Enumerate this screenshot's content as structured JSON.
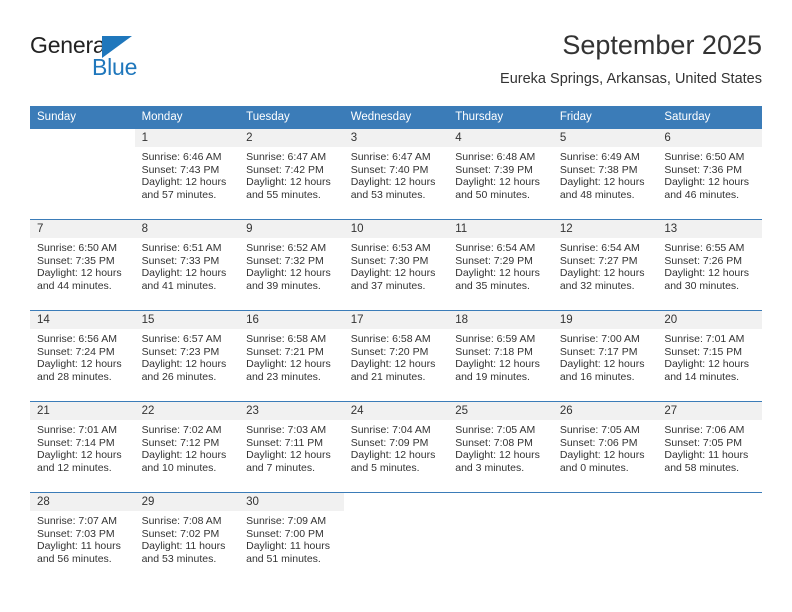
{
  "brand": {
    "name_part1": "General",
    "name_part2": "Blue",
    "accent_color": "#1f77bc"
  },
  "header": {
    "title": "September 2025",
    "subtitle": "Eureka Springs, Arkansas, United States"
  },
  "colors": {
    "header_blue": "#3b7cb8",
    "daynum_background": "#f1f1f1",
    "text": "#333333"
  },
  "weekday_headers": [
    "Sunday",
    "Monday",
    "Tuesday",
    "Wednesday",
    "Thursday",
    "Friday",
    "Saturday"
  ],
  "weeks": [
    [
      {
        "day": "",
        "sunrise": "",
        "sunset": "",
        "daylight_line1": "",
        "daylight_line2": ""
      },
      {
        "day": "1",
        "sunrise": "Sunrise: 6:46 AM",
        "sunset": "Sunset: 7:43 PM",
        "daylight_line1": "Daylight: 12 hours",
        "daylight_line2": "and 57 minutes."
      },
      {
        "day": "2",
        "sunrise": "Sunrise: 6:47 AM",
        "sunset": "Sunset: 7:42 PM",
        "daylight_line1": "Daylight: 12 hours",
        "daylight_line2": "and 55 minutes."
      },
      {
        "day": "3",
        "sunrise": "Sunrise: 6:47 AM",
        "sunset": "Sunset: 7:40 PM",
        "daylight_line1": "Daylight: 12 hours",
        "daylight_line2": "and 53 minutes."
      },
      {
        "day": "4",
        "sunrise": "Sunrise: 6:48 AM",
        "sunset": "Sunset: 7:39 PM",
        "daylight_line1": "Daylight: 12 hours",
        "daylight_line2": "and 50 minutes."
      },
      {
        "day": "5",
        "sunrise": "Sunrise: 6:49 AM",
        "sunset": "Sunset: 7:38 PM",
        "daylight_line1": "Daylight: 12 hours",
        "daylight_line2": "and 48 minutes."
      },
      {
        "day": "6",
        "sunrise": "Sunrise: 6:50 AM",
        "sunset": "Sunset: 7:36 PM",
        "daylight_line1": "Daylight: 12 hours",
        "daylight_line2": "and 46 minutes."
      }
    ],
    [
      {
        "day": "7",
        "sunrise": "Sunrise: 6:50 AM",
        "sunset": "Sunset: 7:35 PM",
        "daylight_line1": "Daylight: 12 hours",
        "daylight_line2": "and 44 minutes."
      },
      {
        "day": "8",
        "sunrise": "Sunrise: 6:51 AM",
        "sunset": "Sunset: 7:33 PM",
        "daylight_line1": "Daylight: 12 hours",
        "daylight_line2": "and 41 minutes."
      },
      {
        "day": "9",
        "sunrise": "Sunrise: 6:52 AM",
        "sunset": "Sunset: 7:32 PM",
        "daylight_line1": "Daylight: 12 hours",
        "daylight_line2": "and 39 minutes."
      },
      {
        "day": "10",
        "sunrise": "Sunrise: 6:53 AM",
        "sunset": "Sunset: 7:30 PM",
        "daylight_line1": "Daylight: 12 hours",
        "daylight_line2": "and 37 minutes."
      },
      {
        "day": "11",
        "sunrise": "Sunrise: 6:54 AM",
        "sunset": "Sunset: 7:29 PM",
        "daylight_line1": "Daylight: 12 hours",
        "daylight_line2": "and 35 minutes."
      },
      {
        "day": "12",
        "sunrise": "Sunrise: 6:54 AM",
        "sunset": "Sunset: 7:27 PM",
        "daylight_line1": "Daylight: 12 hours",
        "daylight_line2": "and 32 minutes."
      },
      {
        "day": "13",
        "sunrise": "Sunrise: 6:55 AM",
        "sunset": "Sunset: 7:26 PM",
        "daylight_line1": "Daylight: 12 hours",
        "daylight_line2": "and 30 minutes."
      }
    ],
    [
      {
        "day": "14",
        "sunrise": "Sunrise: 6:56 AM",
        "sunset": "Sunset: 7:24 PM",
        "daylight_line1": "Daylight: 12 hours",
        "daylight_line2": "and 28 minutes."
      },
      {
        "day": "15",
        "sunrise": "Sunrise: 6:57 AM",
        "sunset": "Sunset: 7:23 PM",
        "daylight_line1": "Daylight: 12 hours",
        "daylight_line2": "and 26 minutes."
      },
      {
        "day": "16",
        "sunrise": "Sunrise: 6:58 AM",
        "sunset": "Sunset: 7:21 PM",
        "daylight_line1": "Daylight: 12 hours",
        "daylight_line2": "and 23 minutes."
      },
      {
        "day": "17",
        "sunrise": "Sunrise: 6:58 AM",
        "sunset": "Sunset: 7:20 PM",
        "daylight_line1": "Daylight: 12 hours",
        "daylight_line2": "and 21 minutes."
      },
      {
        "day": "18",
        "sunrise": "Sunrise: 6:59 AM",
        "sunset": "Sunset: 7:18 PM",
        "daylight_line1": "Daylight: 12 hours",
        "daylight_line2": "and 19 minutes."
      },
      {
        "day": "19",
        "sunrise": "Sunrise: 7:00 AM",
        "sunset": "Sunset: 7:17 PM",
        "daylight_line1": "Daylight: 12 hours",
        "daylight_line2": "and 16 minutes."
      },
      {
        "day": "20",
        "sunrise": "Sunrise: 7:01 AM",
        "sunset": "Sunset: 7:15 PM",
        "daylight_line1": "Daylight: 12 hours",
        "daylight_line2": "and 14 minutes."
      }
    ],
    [
      {
        "day": "21",
        "sunrise": "Sunrise: 7:01 AM",
        "sunset": "Sunset: 7:14 PM",
        "daylight_line1": "Daylight: 12 hours",
        "daylight_line2": "and 12 minutes."
      },
      {
        "day": "22",
        "sunrise": "Sunrise: 7:02 AM",
        "sunset": "Sunset: 7:12 PM",
        "daylight_line1": "Daylight: 12 hours",
        "daylight_line2": "and 10 minutes."
      },
      {
        "day": "23",
        "sunrise": "Sunrise: 7:03 AM",
        "sunset": "Sunset: 7:11 PM",
        "daylight_line1": "Daylight: 12 hours",
        "daylight_line2": "and 7 minutes."
      },
      {
        "day": "24",
        "sunrise": "Sunrise: 7:04 AM",
        "sunset": "Sunset: 7:09 PM",
        "daylight_line1": "Daylight: 12 hours",
        "daylight_line2": "and 5 minutes."
      },
      {
        "day": "25",
        "sunrise": "Sunrise: 7:05 AM",
        "sunset": "Sunset: 7:08 PM",
        "daylight_line1": "Daylight: 12 hours",
        "daylight_line2": "and 3 minutes."
      },
      {
        "day": "26",
        "sunrise": "Sunrise: 7:05 AM",
        "sunset": "Sunset: 7:06 PM",
        "daylight_line1": "Daylight: 12 hours",
        "daylight_line2": "and 0 minutes."
      },
      {
        "day": "27",
        "sunrise": "Sunrise: 7:06 AM",
        "sunset": "Sunset: 7:05 PM",
        "daylight_line1": "Daylight: 11 hours",
        "daylight_line2": "and 58 minutes."
      }
    ],
    [
      {
        "day": "28",
        "sunrise": "Sunrise: 7:07 AM",
        "sunset": "Sunset: 7:03 PM",
        "daylight_line1": "Daylight: 11 hours",
        "daylight_line2": "and 56 minutes."
      },
      {
        "day": "29",
        "sunrise": "Sunrise: 7:08 AM",
        "sunset": "Sunset: 7:02 PM",
        "daylight_line1": "Daylight: 11 hours",
        "daylight_line2": "and 53 minutes."
      },
      {
        "day": "30",
        "sunrise": "Sunrise: 7:09 AM",
        "sunset": "Sunset: 7:00 PM",
        "daylight_line1": "Daylight: 11 hours",
        "daylight_line2": "and 51 minutes."
      },
      {
        "day": "",
        "sunrise": "",
        "sunset": "",
        "daylight_line1": "",
        "daylight_line2": ""
      },
      {
        "day": "",
        "sunrise": "",
        "sunset": "",
        "daylight_line1": "",
        "daylight_line2": ""
      },
      {
        "day": "",
        "sunrise": "",
        "sunset": "",
        "daylight_line1": "",
        "daylight_line2": ""
      },
      {
        "day": "",
        "sunrise": "",
        "sunset": "",
        "daylight_line1": "",
        "daylight_line2": ""
      }
    ]
  ]
}
